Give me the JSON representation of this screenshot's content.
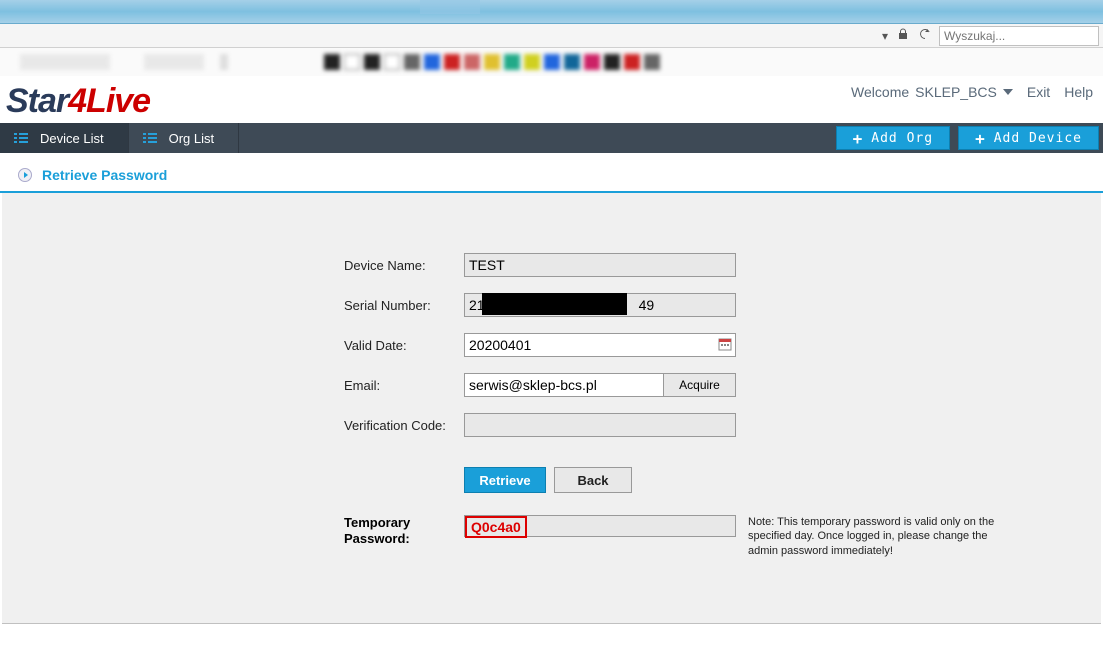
{
  "browser": {
    "search_placeholder": "Wyszukaj..."
  },
  "header": {
    "welcome": "Welcome",
    "user": "SKLEP_BCS",
    "exit": "Exit",
    "help": "Help",
    "logo_part1": "Star",
    "logo_part2": "4Live"
  },
  "nav": {
    "device_list": "Device List",
    "org_list": "Org List",
    "add_org": "Add Org",
    "add_device": "Add Device"
  },
  "page": {
    "title": "Retrieve Password"
  },
  "form": {
    "device_name_label": "Device Name:",
    "device_name_value": "TEST",
    "serial_number_label": "Serial Number:",
    "serial_number_prefix": "21",
    "serial_number_suffix": "49",
    "valid_date_label": "Valid Date:",
    "valid_date_value": "20200401",
    "email_label": "Email:",
    "email_value": "serwis@sklep-bcs.pl",
    "acquire_button": "Acquire",
    "verification_code_label": "Verification Code:",
    "verification_code_value": "",
    "retrieve_button": "Retrieve",
    "back_button": "Back",
    "temporary_password_label": "Temporary Password:",
    "temporary_password_value": "Q0c4a0",
    "temporary_password_note": "Note: This temporary password is valid only on the specified day. Once logged in, please change the admin password immediately!"
  }
}
